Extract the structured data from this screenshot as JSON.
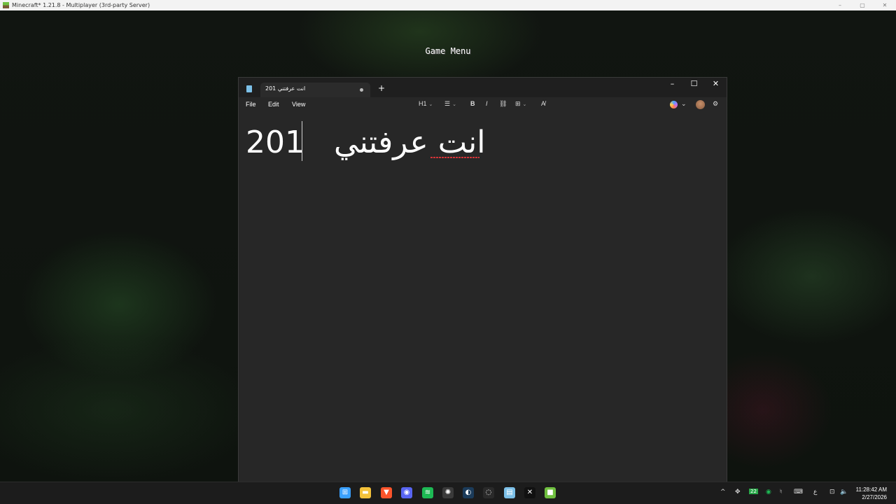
{
  "host_window": {
    "title": "Minecraft* 1.21.8 - Multiplayer (3rd-party Server)",
    "controls": [
      "–",
      "▢",
      "✕"
    ]
  },
  "game": {
    "menu_title": "Game Menu"
  },
  "notepad": {
    "tab_title": "انت عرفتني 201",
    "new_tab_label": "+",
    "window_controls": {
      "minimize": "–",
      "maximize": "☐",
      "close": "✕"
    },
    "menu": {
      "file": "File",
      "edit": "Edit",
      "view": "View"
    },
    "toolbar": {
      "heading": "H1",
      "list": "☰",
      "bold": "B",
      "italic": "I",
      "link": "⛓",
      "table": "⊞",
      "clear_format": "A̸",
      "settings": "⚙"
    },
    "content": {
      "number": "201",
      "arabic": "انت عرفتني"
    },
    "colors": {
      "background": "#272727",
      "titlebar": "#1f1f1f",
      "spellcheck": "#d13438"
    }
  },
  "taskbar": {
    "apps": [
      {
        "icon": "windows-start-icon",
        "glyph": "⊞",
        "color": "#3aa0ff"
      },
      {
        "icon": "file-explorer-icon",
        "glyph": "▬",
        "color": "#f3c13a"
      },
      {
        "icon": "brave-icon",
        "glyph": "▼",
        "color": "#fb542b"
      },
      {
        "icon": "discord-icon",
        "glyph": "◉",
        "color": "#5865f2"
      },
      {
        "icon": "spotify-icon",
        "glyph": "≋",
        "color": "#1db954"
      },
      {
        "icon": "steelseries-icon",
        "glyph": "✺",
        "color": "#3a3a3a"
      },
      {
        "icon": "steam-icon",
        "glyph": "◐",
        "color": "#1b3b5a"
      },
      {
        "icon": "obs-icon",
        "glyph": "◌",
        "color": "#2a2a2a"
      },
      {
        "icon": "notepad-icon",
        "glyph": "▤",
        "color": "#7cc0e8"
      },
      {
        "icon": "capcut-icon",
        "glyph": "✕",
        "color": "#111111"
      },
      {
        "icon": "minecraft-icon",
        "glyph": "■",
        "color": "#6fbf3f"
      }
    ],
    "tray": {
      "chevron": "^",
      "badge": "22",
      "language": "ع",
      "clock_time": "11:28:42 AM",
      "clock_date": "2/27/2026"
    }
  }
}
